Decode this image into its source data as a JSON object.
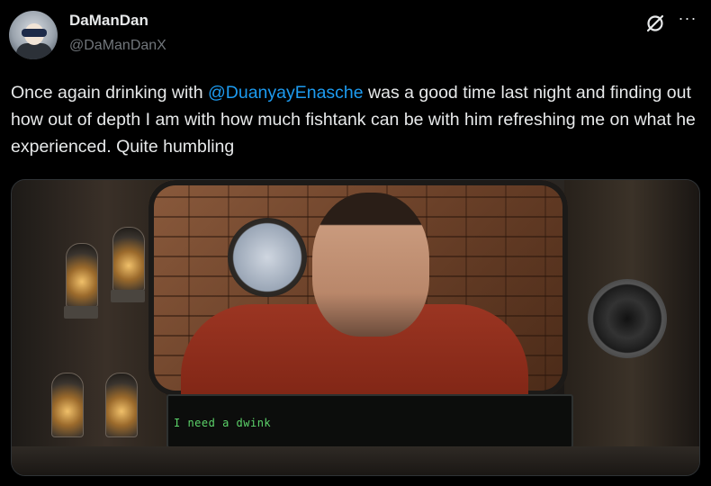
{
  "author": {
    "display_name": "DaManDan",
    "handle": "@DaManDanX",
    "avatar_icon": "avatar-robot-icon"
  },
  "actions": {
    "grok_icon": "grok-icon",
    "more_label": "···"
  },
  "tweet": {
    "text_before": "Once again drinking with ",
    "mention": "@DuanyayEnasche",
    "text_after": " was a good time last night and finding out how out of depth I am with how much fishtank can be with him refreshing me on what he experienced. Quite humbling"
  },
  "media": {
    "dialog_text": "I need a dwink"
  },
  "colors": {
    "background": "#000000",
    "text": "#e7e9ea",
    "secondary": "#71767b",
    "link": "#1d9bf0",
    "dialog_green": "#5cd36a"
  }
}
